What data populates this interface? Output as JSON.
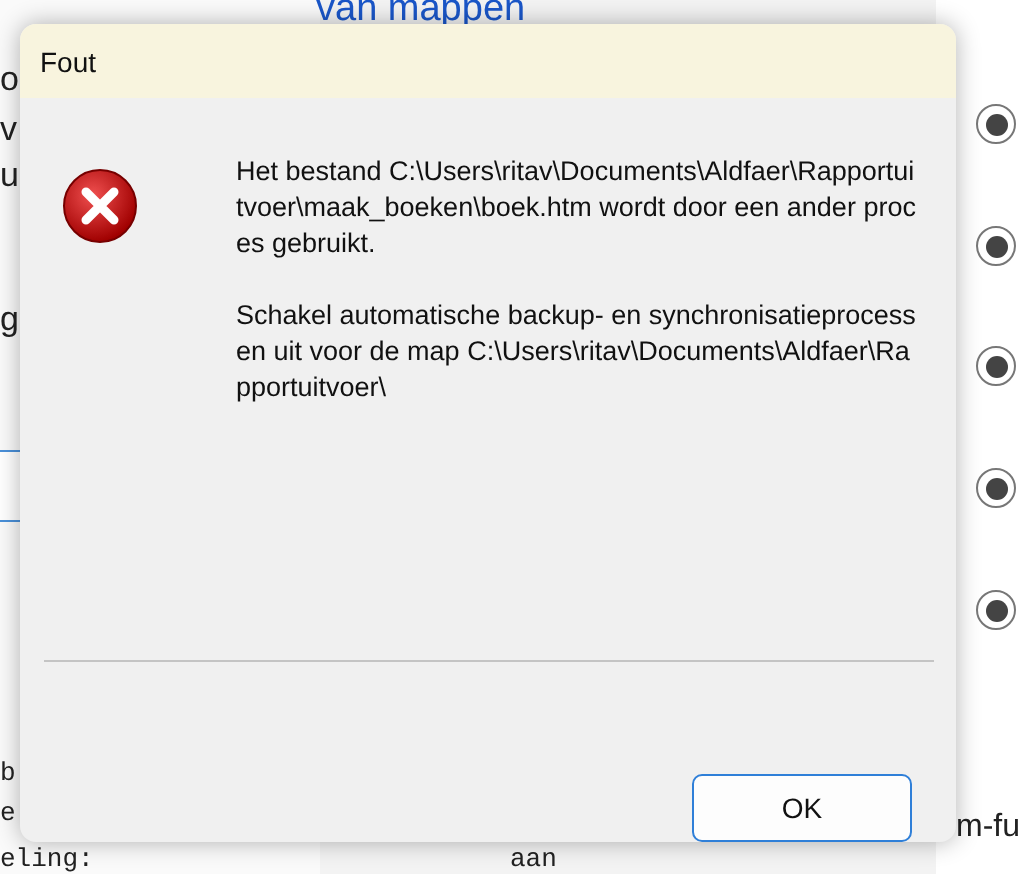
{
  "background": {
    "link": "van mappen",
    "left_fragments": [
      "o",
      "v",
      "u",
      "g"
    ],
    "mono_lines": [
      "b",
      "e",
      "eling:"
    ],
    "mono_value": "aan",
    "right_fragment": "m-fu",
    "radios": [
      {
        "selected": true
      },
      {
        "selected": true
      },
      {
        "selected": true
      },
      {
        "selected": true
      },
      {
        "selected": true
      }
    ]
  },
  "dialog": {
    "title": "Fout",
    "kind": "error",
    "message": [
      "Het bestand C:\\Users\\ritav\\Documents\\Aldfaer\\Rapportuitvoer\\maak_boeken\\boek.htm wordt door een ander proces gebruikt.",
      "Schakel automatische backup- en synchronisatieprocessen uit voor de map C:\\Users\\ritav\\Documents\\Aldfaer\\Rapportuitvoer\\"
    ],
    "buttons": [
      "OK"
    ]
  }
}
